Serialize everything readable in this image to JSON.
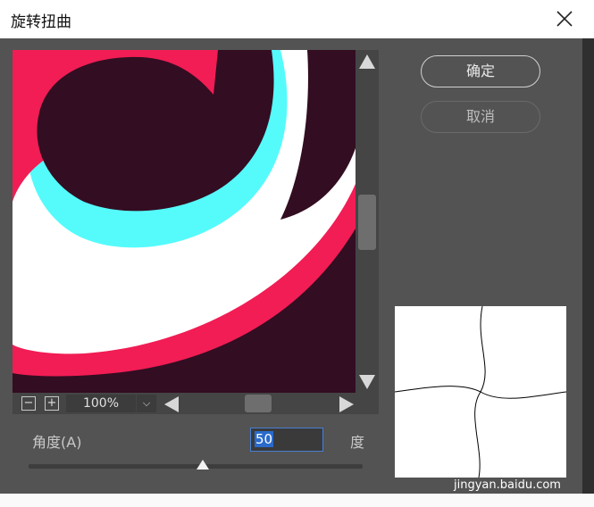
{
  "window": {
    "title": "旋转扭曲"
  },
  "buttons": {
    "ok_label": "确定",
    "cancel_label": "取消"
  },
  "preview": {
    "zoom": "100%",
    "zoom_out_symbol": "−",
    "zoom_in_symbol": "+",
    "dropdown_symbol": "⌵",
    "colors": {
      "dark": "#330d22",
      "red": "#f11d54",
      "cyan": "#55fbfb",
      "white": "#ffffff"
    }
  },
  "angle": {
    "label": "角度(A)",
    "value": "50",
    "unit": "度",
    "slider_value": 50
  },
  "watermark": {
    "text": "jingyan.baidu.com"
  }
}
